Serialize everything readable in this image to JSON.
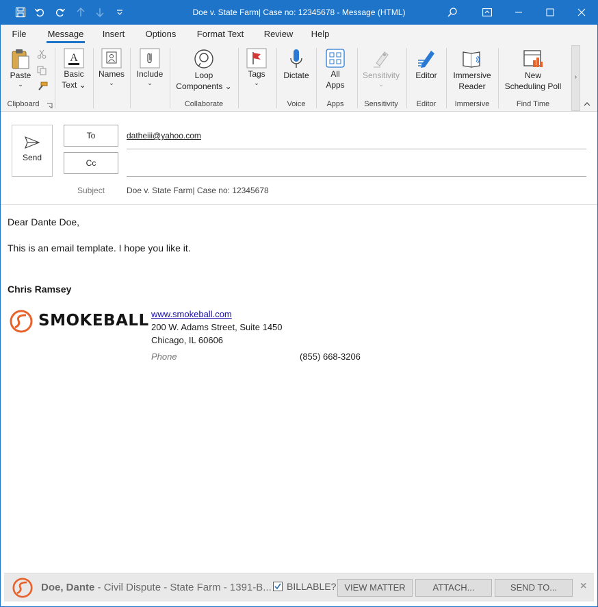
{
  "window": {
    "title": "Doe v. State Farm| Case no: 12345678  -  Message (HTML)"
  },
  "tabs": [
    "File",
    "Message",
    "Insert",
    "Options",
    "Format Text",
    "Review",
    "Help"
  ],
  "ribbon": {
    "paste": "Paste",
    "basic_text_1": "Basic",
    "basic_text_2": "Text",
    "names": "Names",
    "include": "Include",
    "loop_1": "Loop",
    "loop_2": "Components",
    "tags": "Tags",
    "dictate": "Dictate",
    "all_apps_1": "All",
    "all_apps_2": "Apps",
    "sensitivity": "Sensitivity",
    "editor": "Editor",
    "immersive_1": "Immersive",
    "immersive_2": "Reader",
    "poll_1": "New",
    "poll_2": "Scheduling Poll",
    "groups": {
      "clipboard": "Clipboard",
      "collaborate": "Collaborate",
      "voice": "Voice",
      "apps": "Apps",
      "sensitivity": "Sensitivity",
      "editor": "Editor",
      "immersive": "Immersive",
      "find_time": "Find Time"
    }
  },
  "compose": {
    "send": "Send",
    "to_label": "To",
    "cc_label": "Cc",
    "to_value": "datheiii@yahoo.com",
    "subject_label": "Subject",
    "subject_value": "Doe v. State Farm| Case no: 12345678"
  },
  "body": {
    "greeting": "Dear Dante Doe,",
    "line1": "This is an email template. I hope you like it.",
    "signature_name": "Chris Ramsey",
    "logo_text": "SMOKEBALL",
    "website": "www.smokeball.com",
    "address1": "200 W. Adams Street, Suite 1450",
    "address2": "Chicago, IL 60606",
    "phone_label": "Phone",
    "phone_value": "(855) 668-3206"
  },
  "bottom_bar": {
    "matter_client": "Doe, Dante",
    "matter_desc": " - Civil Dispute - State Farm - 1391-B...",
    "billable": "BILLABLE?",
    "billable_checked": true,
    "view_matter": "VIEW MATTER",
    "attach": "ATTACH...",
    "send_to": "SEND TO...",
    "close": "×"
  },
  "colors": {
    "accent": "#1e74c8",
    "brand_orange": "#e8622c",
    "link": "#1a0dab"
  }
}
